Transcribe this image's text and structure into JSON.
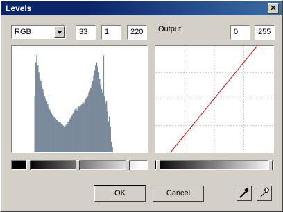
{
  "window": {
    "title": "Levels",
    "close_glyph": "✕"
  },
  "channel": {
    "selected": "RGB"
  },
  "input_levels": {
    "black": "33",
    "gamma": "1",
    "white": "220"
  },
  "output": {
    "label": "Output",
    "black": "0",
    "white": "255"
  },
  "histogram": {
    "color": "#7a8a9a",
    "description_series": [
      0,
      0,
      0,
      0,
      0,
      0,
      0,
      0,
      0,
      0,
      0,
      0,
      0,
      0,
      0,
      0,
      0,
      0,
      0,
      0,
      0,
      0,
      0,
      0.55,
      0.88,
      0.95,
      0.85,
      0.78,
      0.72,
      0.7,
      0.66,
      0.62,
      0.58,
      0.55,
      0.52,
      0.5,
      0.47,
      0.44,
      0.42,
      0.4,
      0.38,
      0.36,
      0.35,
      0.34,
      0.33,
      0.32,
      0.31,
      0.3,
      0.3,
      0.29,
      0.28,
      0.27,
      0.26,
      0.25,
      0.26,
      0.27,
      0.28,
      0.3,
      0.31,
      0.33,
      0.35,
      0.36,
      0.38,
      0.4,
      0.42,
      0.43,
      0.41,
      0.44,
      0.45,
      0.43,
      0.46,
      0.47,
      0.49,
      0.48,
      0.5,
      0.52,
      0.54,
      0.55,
      0.58,
      0.6,
      0.63,
      0.66,
      0.7,
      0.75,
      0.8,
      0.85,
      0.88,
      0.84,
      0.78,
      0.72,
      0.66,
      0.62,
      0.58,
      0.95,
      0.55,
      0.48,
      0.5,
      0.4,
      0.3,
      0.35,
      0.25,
      0.1,
      0.05,
      0,
      0,
      0,
      0,
      0,
      0,
      0,
      0,
      0,
      0,
      0,
      0,
      0,
      0,
      0,
      0,
      0,
      0,
      0,
      0,
      0,
      0,
      0,
      0,
      0,
      0,
      0,
      0,
      0,
      0,
      0,
      0,
      0,
      0,
      0
    ]
  },
  "curve": {
    "color": "#e00000",
    "output_black": 0,
    "output_white": 255,
    "input_black": 33,
    "input_white": 220
  },
  "buttons": {
    "ok": "OK",
    "cancel": "Cancel"
  },
  "icons": {
    "black_eyedropper": "black-eyedropper-icon",
    "white_eyedropper": "white-eyedropper-icon"
  }
}
